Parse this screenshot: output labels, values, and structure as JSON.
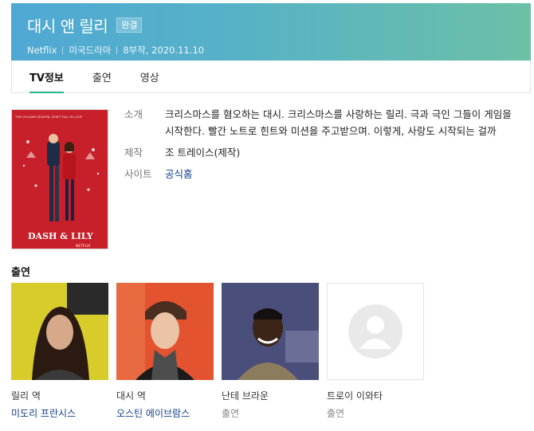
{
  "header": {
    "title": "대시 앤 릴리",
    "badge": "완결",
    "network": "Netflix",
    "genre": "미국드라마",
    "episodes_date": "8부작, 2020.11.10"
  },
  "tabs": [
    {
      "label": "TV정보",
      "active": true
    },
    {
      "label": "출연",
      "active": false
    },
    {
      "label": "영상",
      "active": false
    }
  ],
  "poster": {
    "top_text": "THIS HOLIDAY SEASON, DON'T FALL IN LOVE",
    "logo": "DASH & LILY",
    "brand": "NETFLIX"
  },
  "info": {
    "intro_label": "소개",
    "intro_text": "크리스마스를 혐오하는 대시. 크리스마스를 사랑하는 릴리. 극과 극인 그들이 게임을 시작한다. 빨간 노트로 힌트와 미션을 주고받으며. 이렇게, 사랑도 시작되는 걸까",
    "production_label": "제작",
    "production_value": "조 트레이스(제작)",
    "site_label": "사이트",
    "site_value": "공식홈"
  },
  "cast_section_title": "출연",
  "cast": [
    {
      "role": "릴리 역",
      "name": "미도리 프란시스"
    },
    {
      "role": "대시 역",
      "name": "오스틴 에이브람스"
    },
    {
      "role": "난테 브라운",
      "name": "출연"
    },
    {
      "role": "트로이 이와타",
      "name": "출연"
    }
  ],
  "colors": {
    "header_gradient_start": "#4fa8d4",
    "header_gradient_end": "#6cc0a6",
    "tab_active_underline": "#28b28e",
    "link": "#123f8a",
    "poster_bg": "#c7202a"
  }
}
